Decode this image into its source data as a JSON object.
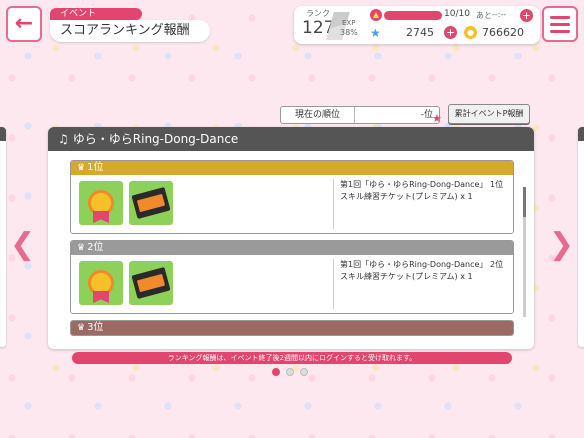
{
  "header": {
    "back_icon": "back-arrow-icon",
    "menu_icon": "hamburger-menu-icon",
    "title_tag": "イベント",
    "title": "スコアランキング報酬"
  },
  "status": {
    "rank_label": "ランク",
    "rank_value": "127",
    "exp_label": "EXP",
    "exp_percent": "38%",
    "stamina_text": "10/10",
    "stamina_fraction": 1.0,
    "stamina_remaining_label": "あと",
    "stamina_time": "--:--",
    "gems": "2745",
    "coins": "766620",
    "accent_color": "#e2466f"
  },
  "current_rank": {
    "label": "現在の順位",
    "value": "-位"
  },
  "event_point_button": "累計イベントP報酬",
  "panel": {
    "title": "ゆら・ゆらRing-Dong-Dance",
    "rewards": [
      {
        "rank": "1位",
        "tier": "gold",
        "desc_line1": "第1回「ゆら・ゆらRing-Dong-Dance」 1位",
        "desc_line2": "スキル練習チケット(プレミアム) x 1"
      },
      {
        "rank": "2位",
        "tier": "silver",
        "desc_line1": "第1回「ゆら・ゆらRing-Dong-Dance」 2位",
        "desc_line2": "スキル練習チケット(プレミアム) x 1"
      },
      {
        "rank": "3位",
        "tier": "bronze"
      }
    ]
  },
  "footer_note": "ランキング報酬は、イベント終了後2週間以内にログインすると受け取れます。",
  "pagination": {
    "current": 1,
    "total": 3
  }
}
